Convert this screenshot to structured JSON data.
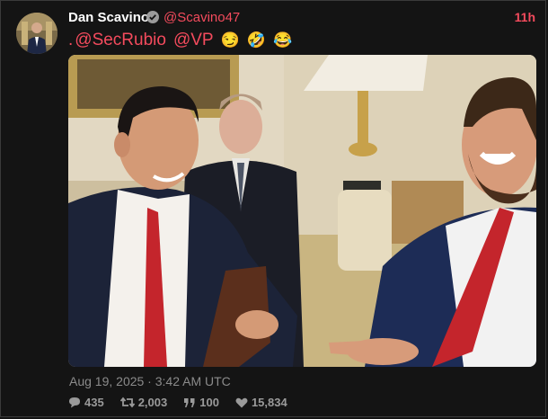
{
  "tweet": {
    "author_name": "Dan Scavino",
    "handle": "@Scavino47",
    "relative_time": "11h",
    "text_prefix": ".",
    "mention1": "@SecRubio",
    "mention2": "@VP",
    "emojis": [
      "😏",
      "🤣",
      "😂"
    ],
    "timestamp": "Aug 19, 2025 · 3:42 AM UTC",
    "stats": {
      "replies": "435",
      "retweets": "2,003",
      "quotes": "100",
      "likes": "15,834"
    }
  },
  "icons": {
    "verified": "verified-badge-icon",
    "reply": "comment-icon",
    "retweet": "retweet-icon",
    "quote": "quote-icon",
    "like": "heart-icon"
  },
  "colors": {
    "accent": "#f44b5d",
    "background": "#141414",
    "muted": "#8b8b8b"
  }
}
